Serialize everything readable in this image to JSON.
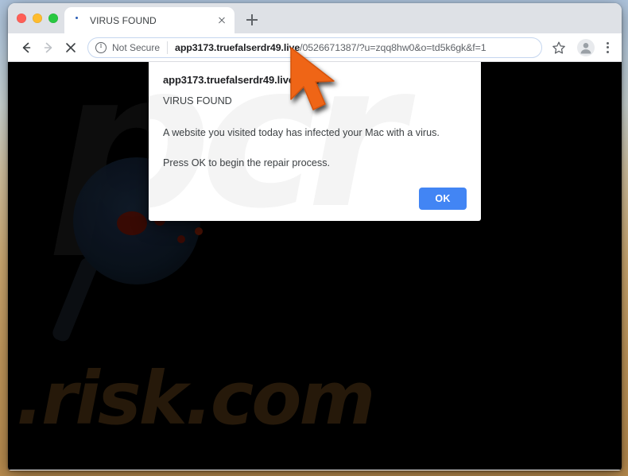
{
  "window": {
    "traffic_lights": [
      "close",
      "minimize",
      "maximize"
    ]
  },
  "tabstrip": {
    "tab_title": "VIRUS FOUND",
    "close_tab_label": "Close tab",
    "new_tab_label": "New Tab"
  },
  "toolbar": {
    "back_label": "Back",
    "forward_label": "Forward",
    "stop_label": "Stop loading this page",
    "security_label": "Not Secure",
    "url_host": "app3173.truefalserdr49.live",
    "url_path": "/0526671387/?u=zqq8hw0&o=td5k6gk&f=1",
    "url_full": "app3173.truefalserdr49.live/0526671387/?u=zqq8hw0&o=td5k6gk&f=1",
    "bookmark_label": "Bookmark this tab",
    "profile_label": "Profile",
    "menu_label": "Customize and control Google Chrome"
  },
  "page": {
    "watermark_logo": "pcr",
    "watermark_domain": ".risk.com",
    "background_color": "#000000"
  },
  "dialog": {
    "origin": "app3173.truefalserdr49.live says",
    "heading": "VIRUS FOUND",
    "lines": [
      "A website you visited today has infected your Mac with a virus.",
      "Press OK to begin the repair process."
    ],
    "ok_label": "OK",
    "accent_color": "#4285f4"
  },
  "cursor": {
    "color": "#ef6516",
    "type": "arrow-pointer"
  }
}
